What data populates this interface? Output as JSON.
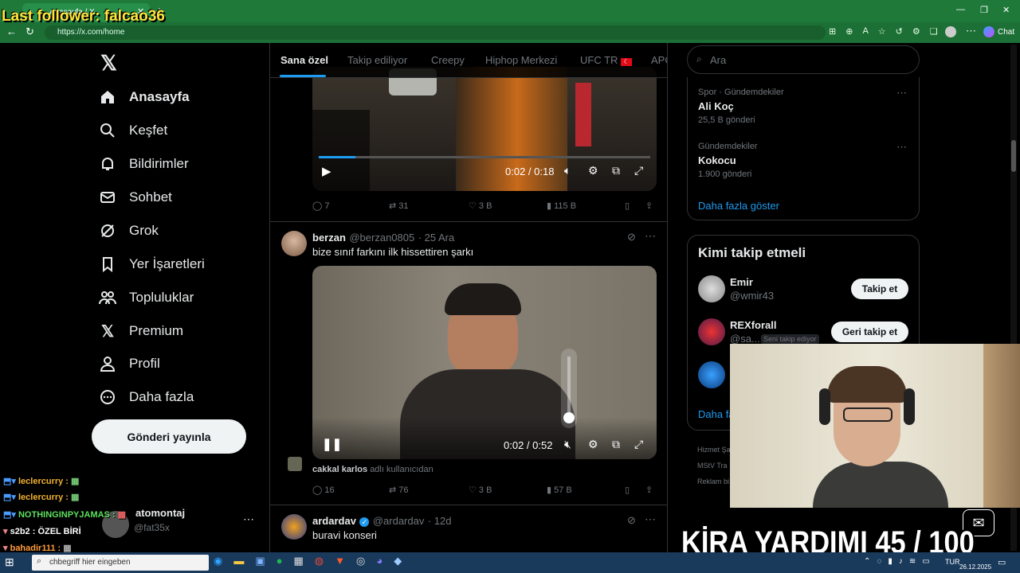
{
  "overlay": {
    "last_follower": "Last follower: falcao36",
    "kira": "KİRA YARDIMI  45 / 100",
    "chat": [
      {
        "user": "leclercurry :",
        "color": "#f0b030"
      },
      {
        "user": "leclercurry :",
        "color": "#f0b030"
      },
      {
        "user": "NOTHINGINPYJAMAS :",
        "color": "#5ce05c"
      },
      {
        "user": "s2b2 : ÖZEL BİRİ",
        "color": "#ffffff"
      },
      {
        "user": "bahadir111 :",
        "color": "#ff9a3c"
      }
    ]
  },
  "browser": {
    "tab_title": "Anasayfa / X",
    "url": "https://x.com/home",
    "chat_label": "Chat"
  },
  "nav": {
    "items": [
      {
        "label": "Anasayfa",
        "icon": "home-icon"
      },
      {
        "label": "Keşfet",
        "icon": "search-icon"
      },
      {
        "label": "Bildirimler",
        "icon": "bell-icon"
      },
      {
        "label": "Sohbet",
        "icon": "mail-icon"
      },
      {
        "label": "Grok",
        "icon": "grok-icon"
      },
      {
        "label": "Yer İşaretleri",
        "icon": "bookmark-icon"
      },
      {
        "label": "Topluluklar",
        "icon": "communities-icon"
      },
      {
        "label": "Premium",
        "icon": "x-logo-icon"
      },
      {
        "label": "Profil",
        "icon": "user-icon"
      },
      {
        "label": "Daha fazla",
        "icon": "more-circle-icon"
      }
    ],
    "post_button": "Gönderi yayınla",
    "account_name": "atomontaj",
    "account_handle": "@fat35x"
  },
  "feed": {
    "tabs": [
      "Sana özel",
      "Takip ediliyor",
      "Creepy",
      "Hiphop Merkezi",
      "UFC TR",
      "APC"
    ],
    "post1": {
      "video_time": "0:02 / 0:18",
      "replies": "7",
      "reposts": "31",
      "likes": "3 B",
      "views": "115 B"
    },
    "post2": {
      "name": "berzan",
      "handle": "@berzan0805",
      "date": "· 25 Ara",
      "text": "bize sınıf farkını ilk hissettiren şarkı",
      "video_time": "0:02 / 0:52",
      "credit_user": "cakkal karlos",
      "credit_suffix": "adlı kullanıcıdan",
      "replies": "16",
      "reposts": "76",
      "likes": "3 B",
      "views": "57 B"
    },
    "post3": {
      "name": "ardardav",
      "handle": "@ardardav",
      "date": "· 12d",
      "text": "buravi konseri"
    }
  },
  "right": {
    "search_placeholder": "Ara",
    "trends": [
      {
        "category": "Spor · Gündemdekiler",
        "title": "Ali Koç",
        "count": "25,5 B gönderi"
      },
      {
        "category": "Gündemdekiler",
        "title": "Kokocu",
        "count": "1.900 gönderi"
      }
    ],
    "show_more": "Daha fazla göster",
    "who_to_follow": {
      "title": "Kimi takip etmeli",
      "users": [
        {
          "name": "Emir",
          "handle": "@wmir43",
          "button": "Takip et"
        },
        {
          "name": "REXforall",
          "handle": "@sa...",
          "badge": "Seni takip ediyor",
          "button": "Geri takip et"
        }
      ],
      "show_more": "Daha fa"
    },
    "footer": [
      "Hizmet Şa",
      "MStV Tra",
      "Reklam bi"
    ]
  },
  "taskbar": {
    "search_placeholder": "chbegriff hier eingeben",
    "lang": "TUR",
    "date": "26.12.2025"
  },
  "colors": {
    "accent": "#1d9bf0",
    "chrome": "#1f7a3a",
    "bg": "#000000"
  }
}
